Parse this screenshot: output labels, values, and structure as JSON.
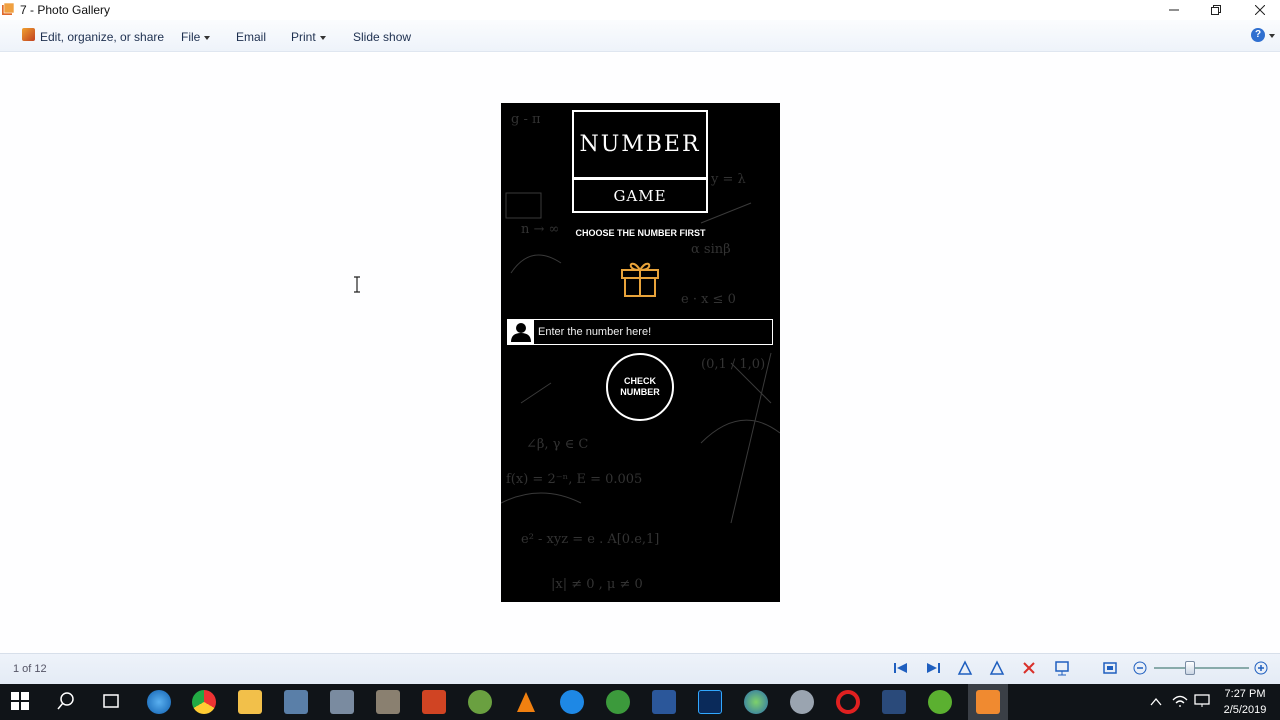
{
  "window": {
    "title": "7 - Photo Gallery"
  },
  "commandbar": {
    "edit_label": "Edit, organize, or share",
    "file_label": "File",
    "email_label": "Email",
    "print_label": "Print",
    "slideshow_label": "Slide show"
  },
  "photo": {
    "logo_top": "NUMBER",
    "logo_bottom": "GAME",
    "subtitle": "CHOOSE THE NUMBER FIRST",
    "input_placeholder": "Enter the number here!",
    "check_button": "CHECK NUMBER"
  },
  "statusbar": {
    "page_count": "1 of 12"
  },
  "taskbar": {
    "time": "7:27 PM",
    "date": "2/5/2019"
  },
  "colors": {
    "accent": "#2f6fd0",
    "gift": "#e8a33a",
    "close_red": "#d9302a"
  }
}
